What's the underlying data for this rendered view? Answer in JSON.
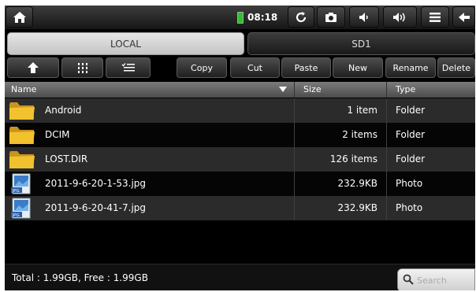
{
  "status_bar": {
    "time": "08:18",
    "icons": [
      "home-icon",
      "battery-icon",
      "refresh-icon",
      "camera-icon",
      "volume-down-icon",
      "volume-up-icon",
      "menu-icon",
      "back-icon"
    ]
  },
  "tabs": [
    {
      "label": "LOCAL",
      "selected": true
    },
    {
      "label": "SD1",
      "selected": false
    }
  ],
  "toolbar": {
    "icon_buttons": [
      "up-arrow-icon",
      "grid-view-icon",
      "list-check-icon"
    ],
    "copy": "Copy",
    "cut": "Cut",
    "paste": "Paste",
    "new": "New",
    "rename": "Rename",
    "delete": "Delete"
  },
  "table": {
    "columns": {
      "name": "Name",
      "size": "Size",
      "type": "Type"
    },
    "rows": [
      {
        "name": "Android",
        "size": "1 item",
        "type": "Folder",
        "icon": "folder-icon"
      },
      {
        "name": "DCIM",
        "size": "2 items",
        "type": "Folder",
        "icon": "folder-icon"
      },
      {
        "name": "LOST.DIR",
        "size": "126 items",
        "type": "Folder",
        "icon": "folder-icon"
      },
      {
        "name": "2011-9-6-20-1-53.jpg",
        "size": "232.9KB",
        "type": "Photo",
        "icon": "jpg-file-icon"
      },
      {
        "name": "2011-9-6-20-41-7.jpg",
        "size": "232.9KB",
        "type": "Photo",
        "icon": "jpg-file-icon"
      }
    ]
  },
  "footer": {
    "total": "Total : 1.99GB, Free : 1.99GB",
    "search_placeholder": "Search"
  },
  "colors": {
    "background": "#000000",
    "row_alt": "#2b2b2b",
    "tab_selected": "#d6d6d6",
    "folder": "#f2c12e",
    "battery": "#2fbf2f"
  }
}
